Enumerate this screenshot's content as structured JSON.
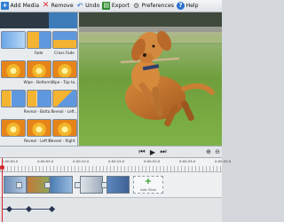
{
  "toolbar": {
    "items": [
      {
        "label": "Add Media",
        "icon": "add-media-icon"
      },
      {
        "label": "Remove",
        "icon": "remove-x-icon"
      },
      {
        "label": "Undo",
        "icon": "undo-arrow-icon"
      },
      {
        "label": "Export",
        "icon": "export-icon"
      },
      {
        "label": "Preferences",
        "icon": "gear-icon"
      },
      {
        "label": "Help",
        "icon": "help-icon"
      }
    ]
  },
  "transitions": {
    "items": [
      {
        "label": "",
        "style": "t-blue"
      },
      {
        "label": "Fade",
        "style": "t-half"
      },
      {
        "label": "Cross Fade",
        "style": "t-split"
      },
      {
        "label": "",
        "style": "t-sun"
      },
      {
        "label": "Wipe - Bottom...",
        "style": "t-sun"
      },
      {
        "label": "Wipe - Top to...",
        "style": "t-sun"
      },
      {
        "label": "",
        "style": "t-wipe"
      },
      {
        "label": "Reveal - Botto...",
        "style": "t-wipe"
      },
      {
        "label": "Reveal - Left...",
        "style": "t-diag"
      },
      {
        "label": "",
        "style": "t-sun"
      },
      {
        "label": "Reveal - Left t...",
        "style": "t-sun"
      },
      {
        "label": "Reveal - Right ...",
        "style": "t-sun"
      }
    ]
  },
  "controls": {
    "rewind_icon": "skip-back-icon",
    "play_icon": "play-icon",
    "forward_icon": "skip-forward-icon",
    "zoom_in_icon": "zoom-in-icon",
    "zoom_out_icon": "zoom-out-icon"
  },
  "ruler": {
    "times": [
      "0:00:00.0",
      "0:00:05.0",
      "0:00:10.0",
      "0:00:15.0",
      "0:00:20.0",
      "0:00:25.0",
      "0:00:30.0"
    ]
  },
  "timeline": {
    "add_slide_label": "Add Slide"
  }
}
